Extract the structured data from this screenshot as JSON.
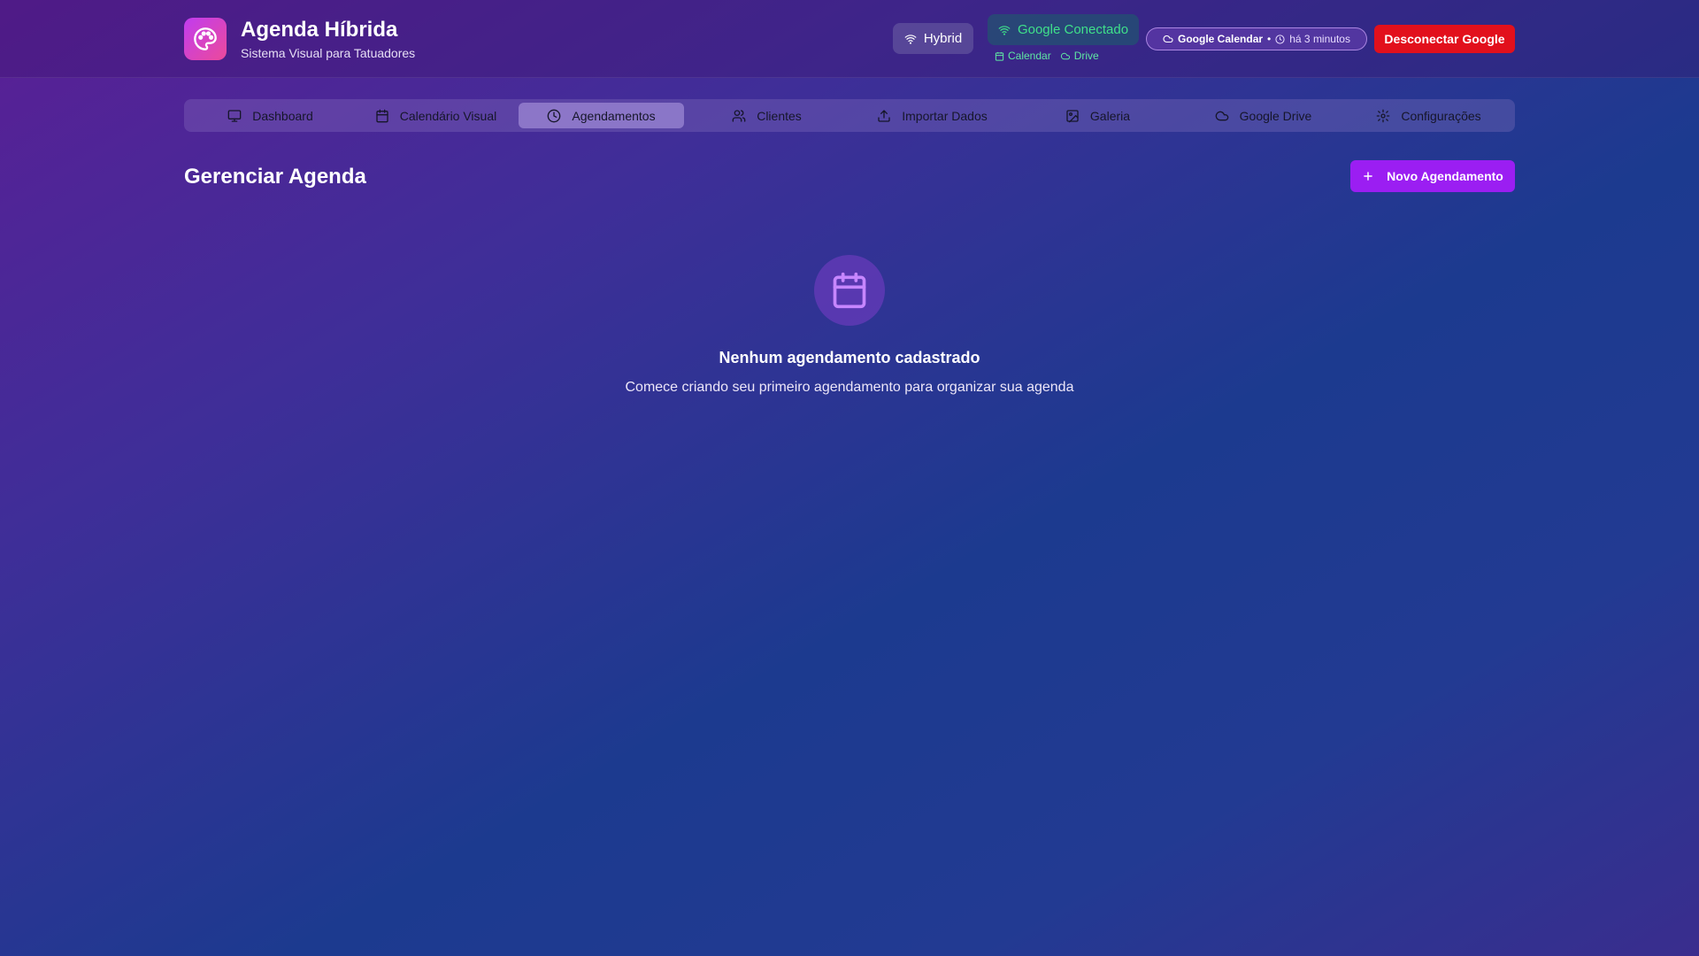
{
  "header": {
    "title": "Agenda Híbrida",
    "subtitle": "Sistema Visual para Tatuadores",
    "hybrid_label": "Hybrid",
    "google_status": "Google Conectado",
    "sub_links": {
      "calendar": "Calendar",
      "drive": "Drive"
    },
    "sync": {
      "service": "Google Calendar",
      "separator": "•",
      "time": "há 3 minutos"
    },
    "disconnect_label": "Desconectar Google"
  },
  "nav": {
    "items": [
      {
        "label": "Dashboard",
        "icon": "monitor-icon",
        "active": false
      },
      {
        "label": "Calendário Visual",
        "icon": "calendar-icon",
        "active": false
      },
      {
        "label": "Agendamentos",
        "icon": "clock-icon",
        "active": true
      },
      {
        "label": "Clientes",
        "icon": "users-icon",
        "active": false
      },
      {
        "label": "Importar Dados",
        "icon": "upload-icon",
        "active": false
      },
      {
        "label": "Galeria",
        "icon": "image-icon",
        "active": false
      },
      {
        "label": "Google Drive",
        "icon": "cloud-icon",
        "active": false
      },
      {
        "label": "Configurações",
        "icon": "gear-icon",
        "active": false
      }
    ]
  },
  "main": {
    "title": "Gerenciar Agenda",
    "new_button": "Novo Agendamento",
    "empty_state": {
      "title": "Nenhum agendamento cadastrado",
      "description": "Comece criando seu primeiro agendamento para organizar sua agenda"
    }
  },
  "colors": {
    "accent": "#9b1ef2",
    "danger": "#e2101c",
    "success": "#3fe08a"
  }
}
